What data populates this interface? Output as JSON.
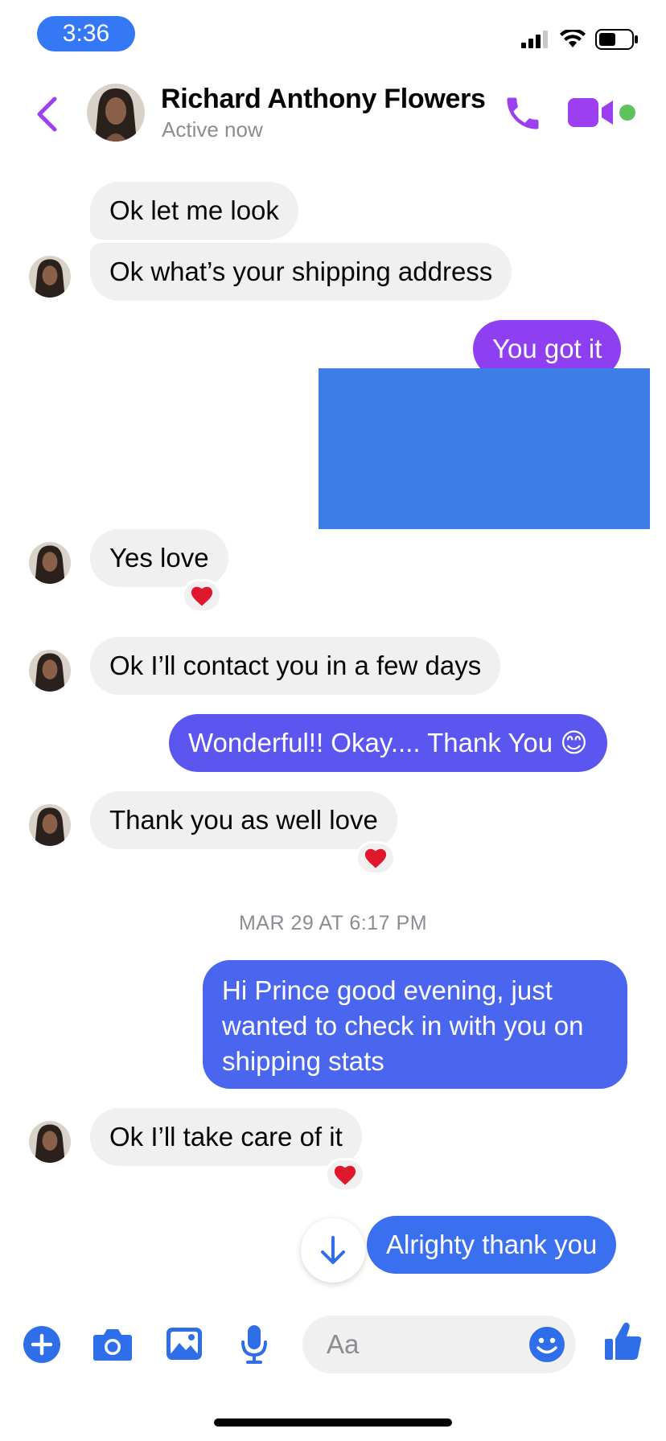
{
  "status_bar": {
    "time": "3:36"
  },
  "header": {
    "contact_name": "Richard Anthony Flowers",
    "status": "Active now"
  },
  "messages": [
    {
      "side": "incoming",
      "text": "Ok let me look"
    },
    {
      "side": "incoming",
      "text": "Ok what’s your shipping address"
    },
    {
      "side": "outgoing",
      "text": "You got it"
    },
    {
      "side": "incoming",
      "text": "Yes love",
      "reaction": "heart"
    },
    {
      "side": "incoming",
      "text": "Ok I’ll contact you in a few days"
    },
    {
      "side": "outgoing",
      "text": "Wonderful!! Okay.... Thank You 😊"
    },
    {
      "side": "incoming",
      "text": "Thank you as well love",
      "reaction": "heart"
    },
    {
      "side": "outgoing",
      "text": "Hi Prince good evening, just wanted to check in with you on shipping stats"
    },
    {
      "side": "incoming",
      "text": "Ok I’ll take care of it",
      "reaction": "heart"
    },
    {
      "side": "outgoing",
      "text": "Alrighty thank you"
    }
  ],
  "timestamp_divider": "MAR 29 AT 6:17 PM",
  "composer": {
    "placeholder": "Aa",
    "icons": [
      "plus-icon",
      "camera-icon",
      "image-icon",
      "microphone-icon",
      "emoji-icon",
      "thumbs-up-icon"
    ]
  },
  "colors": {
    "accent_purple": "#9b3ff0",
    "bubble_purple": "#8e3ff2",
    "bubble_indigo": "#5c56f0",
    "bubble_blue": "#3a6ff0",
    "incoming_bubble": "#f0f0f0",
    "composer_blue": "#2e6ee8",
    "online_green": "#5ec25e"
  }
}
